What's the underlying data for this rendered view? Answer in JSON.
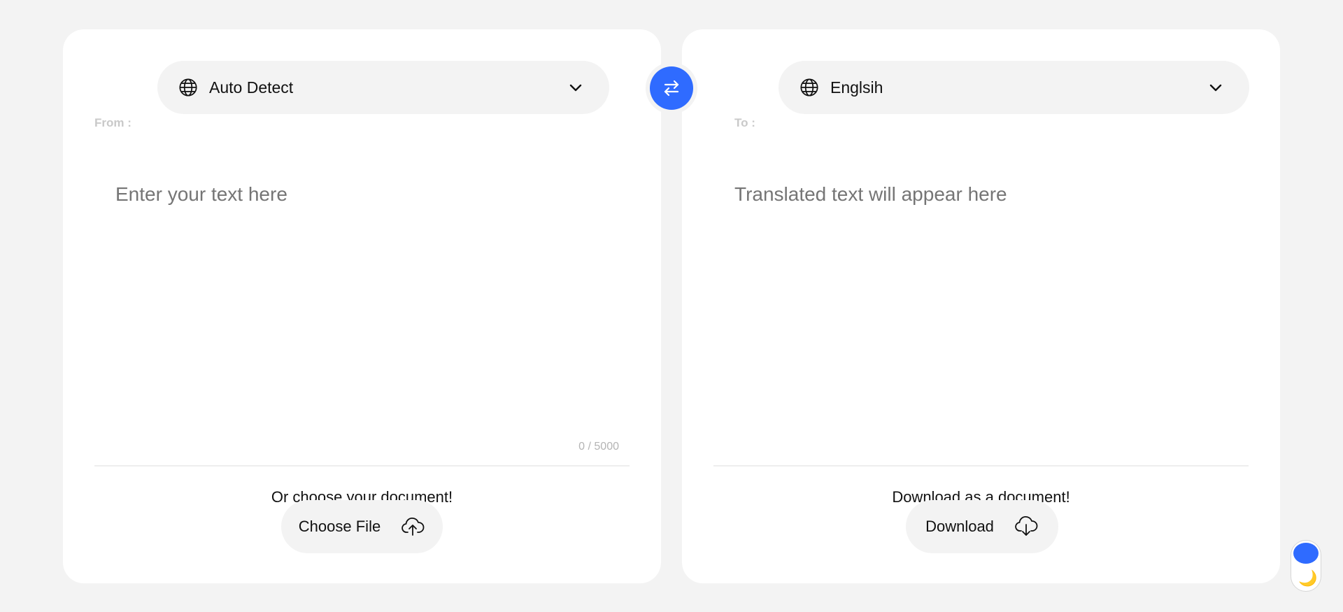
{
  "source": {
    "label": "From :",
    "language": "Auto Detect",
    "placeholder": "Enter your text here",
    "counter": "0 / 5000",
    "caption": "Or choose your document!",
    "button_label": "Choose File",
    "button_icon": "cloud-upload-icon"
  },
  "target": {
    "label": "To :",
    "language": "Englsih",
    "placeholder": "Translated text will appear here",
    "caption": "Download as a document!",
    "button_label": "Download",
    "button_icon": "cloud-download-icon"
  },
  "swap": {
    "icon": "swap-arrows-icon"
  },
  "theme_toggle": {
    "icon": "moon-icon",
    "moon_glyph": "🌙"
  },
  "colors": {
    "accent": "#2f6bff",
    "background": "#f3f3f3",
    "panel": "#ffffff",
    "placeholder": "#7a7470",
    "label_muted": "#c9c9c9"
  }
}
